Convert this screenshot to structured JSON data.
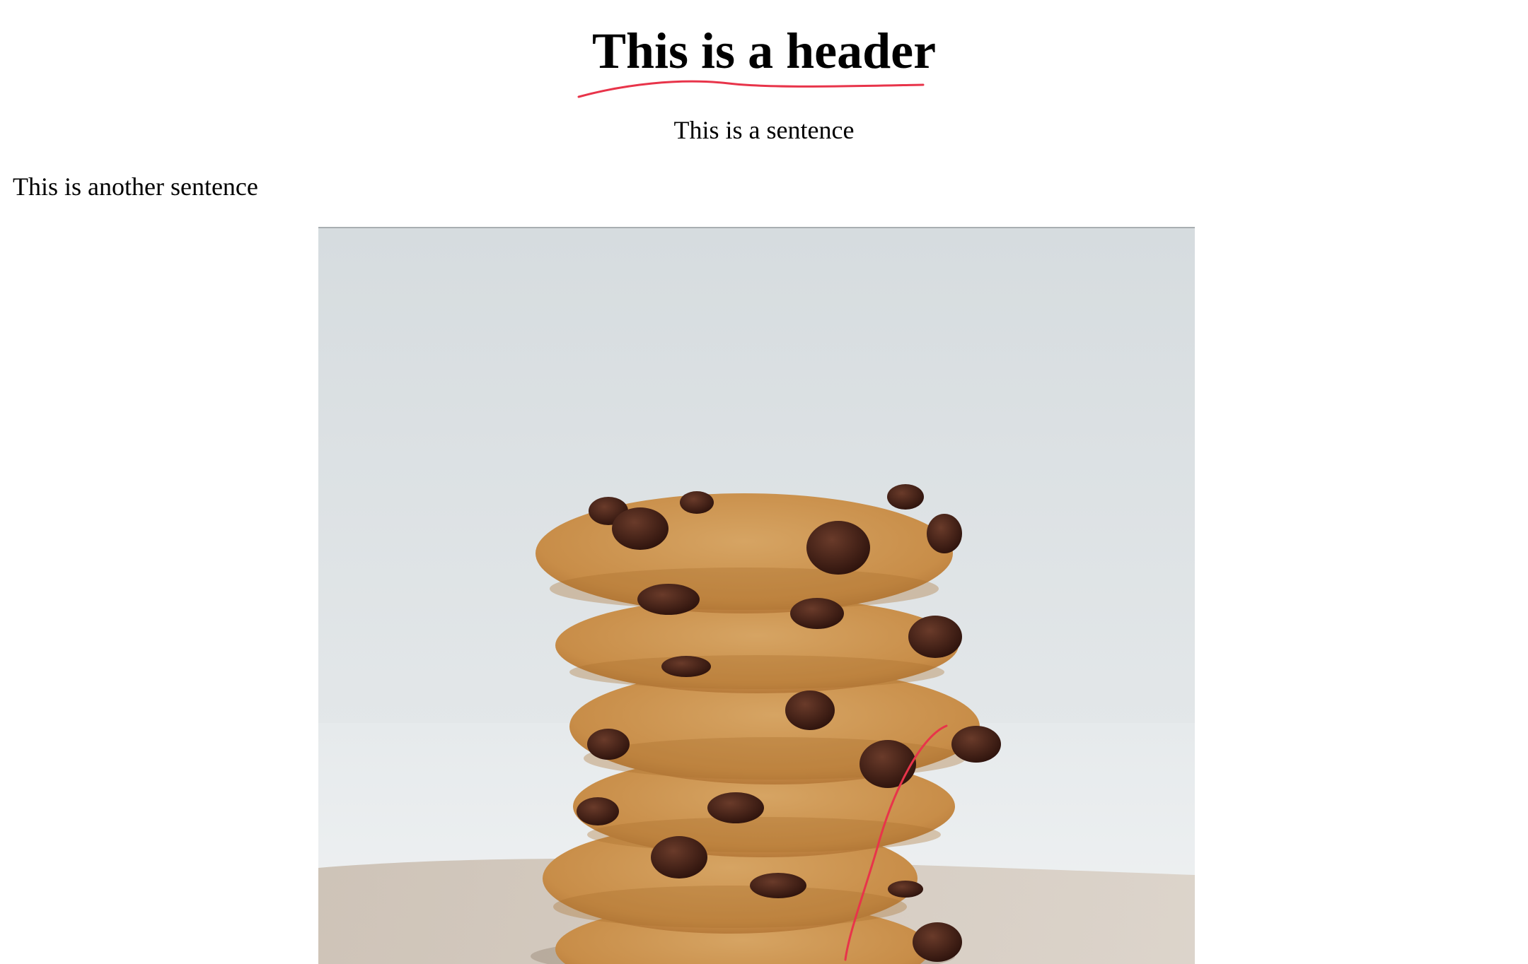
{
  "header": {
    "title": "This is a header"
  },
  "content": {
    "sentence_centered": "This is a sentence",
    "sentence_left": "This is another sentence"
  },
  "image": {
    "subject": "stack of chocolate chip cookies"
  },
  "annotations": {
    "stroke_color": "#e8344a"
  }
}
